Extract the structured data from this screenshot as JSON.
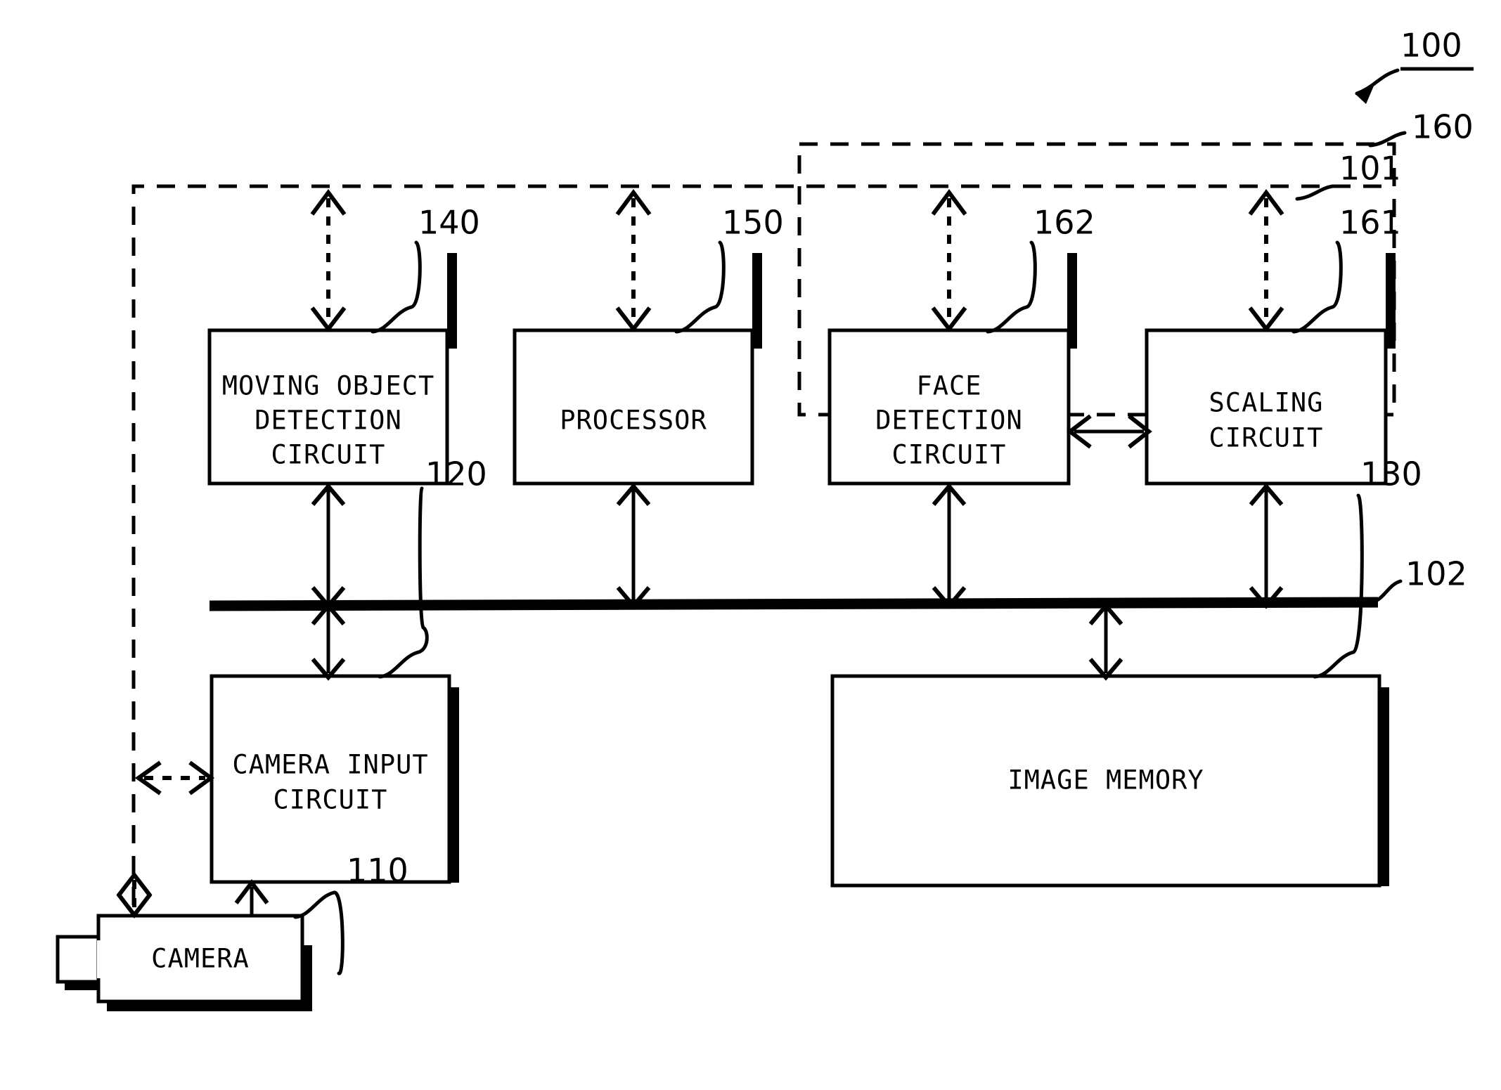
{
  "figure": {
    "title_ref": "100",
    "blocks": [
      {
        "id": "camera",
        "ref": "110",
        "lines": [
          "CAMERA"
        ]
      },
      {
        "id": "camera_input",
        "ref": "120",
        "lines": [
          "CAMERA INPUT",
          "CIRCUIT"
        ]
      },
      {
        "id": "image_memory",
        "ref": "130",
        "lines": [
          "IMAGE MEMORY"
        ]
      },
      {
        "id": "moving_obj",
        "ref": "140",
        "lines": [
          "MOVING OBJECT",
          "DETECTION",
          "CIRCUIT"
        ]
      },
      {
        "id": "processor",
        "ref": "150",
        "lines": [
          "PROCESSOR"
        ]
      },
      {
        "id": "scaling",
        "ref": "161",
        "lines": [
          "SCALING",
          "CIRCUIT"
        ]
      },
      {
        "id": "face_detect",
        "ref": "162",
        "lines": [
          "FACE",
          "DETECTION",
          "CIRCUIT"
        ]
      }
    ],
    "boundaries": [
      {
        "id": "group_160",
        "ref": "160"
      },
      {
        "id": "group_101",
        "ref": "101"
      }
    ],
    "bus": {
      "id": "bus_102",
      "ref": "102"
    },
    "colors": {
      "ink": "#000000",
      "paper": "#ffffff"
    }
  }
}
